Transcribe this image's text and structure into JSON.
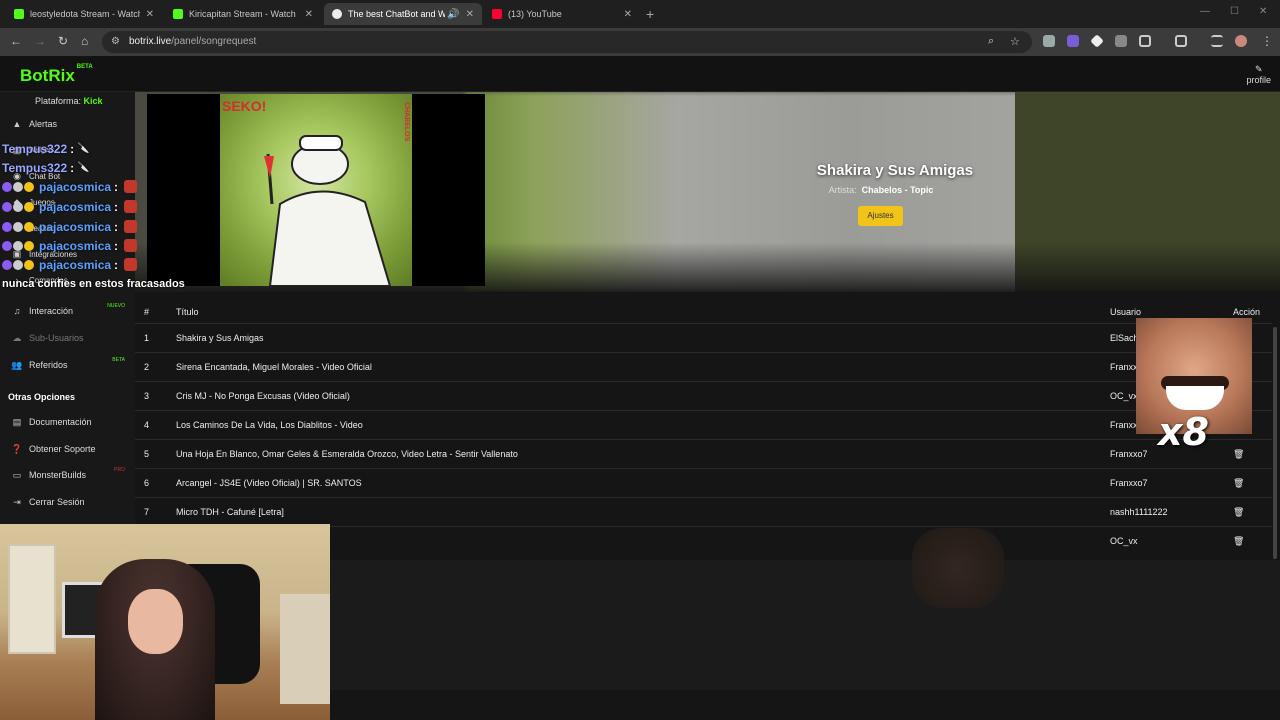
{
  "browser": {
    "tabs": [
      {
        "label": "leostyledota Stream - Watch Li",
        "active": false,
        "icon": "kick-icon"
      },
      {
        "label": "Kiricapitan Stream - Watch Live",
        "active": false,
        "icon": "kick-icon"
      },
      {
        "label": "The best ChatBot and Widg",
        "active": true,
        "icon": "botrix-icon"
      },
      {
        "label": "(13) YouTube",
        "active": false,
        "icon": "youtube-icon"
      }
    ],
    "url_host": "botrix.live",
    "url_path": "/panel/songrequest"
  },
  "app": {
    "logo": "BotRix",
    "logo_badge": "BETA",
    "profile_label": "profile"
  },
  "sidebar": {
    "platform_label": "Plataforma:",
    "platform_value": "Kick",
    "items_top": [
      {
        "label": "Alertas",
        "icon": "warning-icon"
      },
      {
        "label": "Widgets",
        "icon": "widget-icon"
      },
      {
        "label": "Chat Bot",
        "icon": "robot-icon"
      },
      {
        "label": "Juegos",
        "icon": "gamepad-icon"
      },
      {
        "label": "Lealtad",
        "icon": "star-icon"
      },
      {
        "label": "Integraciones",
        "icon": "plug-icon"
      },
      {
        "label": "Comandos",
        "icon": "terminal-icon"
      }
    ],
    "items_mid": [
      {
        "label": "Interacción",
        "icon": "music-icon",
        "tag": "NUEVO",
        "dim": false
      },
      {
        "label": "Sub-Usuarios",
        "icon": "cloud-icon",
        "tag": "",
        "dim": true
      },
      {
        "label": "Referidos",
        "icon": "users-icon",
        "tag": "BETA",
        "dim": false
      }
    ],
    "section_other": "Otras Opciones",
    "items_other": [
      {
        "label": "Documentación",
        "icon": "book-icon",
        "tag": ""
      },
      {
        "label": "Obtener Soporte",
        "icon": "question-icon",
        "tag": ""
      },
      {
        "label": "MonsterBuilds",
        "icon": "laptop-icon",
        "tag": "PRO"
      },
      {
        "label": "Cerrar Sesión",
        "icon": "logout-icon",
        "tag": ""
      }
    ]
  },
  "now_playing": {
    "cover_text_left": "SEKO!",
    "cover_text_right": "CHABELOS",
    "title": "Shakira y Sus Amigas",
    "artist_label": "Artista:",
    "artist": "Chabelos - Topic",
    "settings_button": "Ajustes"
  },
  "queue": {
    "headers": {
      "num": "#",
      "title": "Título",
      "user": "Usuario",
      "action": "Acción"
    },
    "rows": [
      {
        "num": "1",
        "title": "Shakira y Sus Amigas",
        "user": "ElSach"
      },
      {
        "num": "2",
        "title": "Sirena Encantada, Miguel Morales - Video Oficial",
        "user": "Franxx"
      },
      {
        "num": "3",
        "title": "Cris MJ - No Ponga Excusas (Video Oficial)",
        "user": "OC_vx"
      },
      {
        "num": "4",
        "title": "Los Caminos De La Vida, Los Diablitos - Video",
        "user": "Franxx"
      },
      {
        "num": "5",
        "title": "Una Hoja En Blanco, Omar Geles & Esmeralda Orozco, Video Letra - Sentir Vallenato",
        "user": "Franxxo7"
      },
      {
        "num": "6",
        "title": "Arcangel - JS4E (Video Oficial) | SR. SANTOS",
        "user": "Franxxo7"
      },
      {
        "num": "7",
        "title": "Micro TDH - Cafuné [Letra]",
        "user": "nashh1111222"
      },
      {
        "num": "",
        "title": "",
        "user": "OC_vx"
      }
    ]
  },
  "overlay": {
    "chat": [
      {
        "user": "Tempus322",
        "style": "user1",
        "badges": 0,
        "emote": "knife"
      },
      {
        "user": "Tempus322",
        "style": "user1",
        "badges": 0,
        "emote": "knife"
      },
      {
        "user": "pajacosmica",
        "style": "user2",
        "badges": 3,
        "emote": "mask"
      },
      {
        "user": "pajacosmica",
        "style": "user2",
        "badges": 3,
        "emote": "mask"
      },
      {
        "user": "pajacosmica",
        "style": "user2",
        "badges": 3,
        "emote": "mask"
      },
      {
        "user": "pajacosmica",
        "style": "user2",
        "badges": 3,
        "emote": "mask"
      },
      {
        "user": "pajacosmica",
        "style": "user2",
        "badges": 3,
        "emote": "mask"
      }
    ],
    "chat_colon": ":",
    "chat_message": "nunca confies en estos fracasados",
    "multiplier": "x8"
  }
}
